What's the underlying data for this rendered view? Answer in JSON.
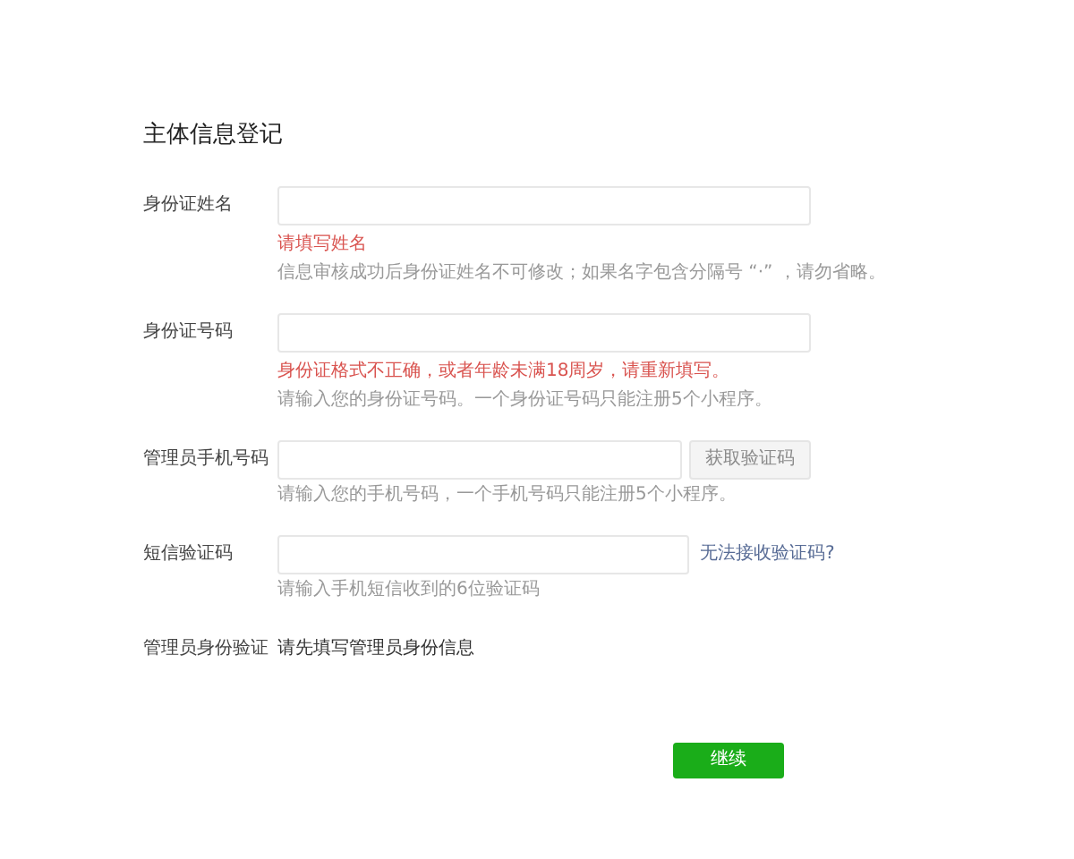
{
  "title": "主体信息登记",
  "fields": [
    {
      "kind": "text",
      "label": "身份证姓名",
      "error": "请填写姓名",
      "hint": "信息审核成功后身份证姓名不可修改；如果名字包含分隔号 “·” ，请勿省略。"
    },
    {
      "kind": "text",
      "label": "身份证号码",
      "error": "身份证格式不正确，或者年龄未满18周岁，请重新填写。",
      "hint": "请输入您的身份证号码。一个身份证号码只能注册5个小程序。"
    },
    {
      "kind": "button",
      "label": "管理员手机号码",
      "button": {
        "label": "获取验证码",
        "disabled": true
      },
      "hint": "请输入您的手机号码，一个手机号码只能注册5个小程序。"
    },
    {
      "kind": "link",
      "label": "短信验证码",
      "link": "无法接收验证码?",
      "hint": "请输入手机短信收到的6位验证码"
    },
    {
      "kind": "info",
      "label": "管理员身份验证",
      "text": "请先填写管理员身份信息"
    }
  ],
  "submit": "继续"
}
